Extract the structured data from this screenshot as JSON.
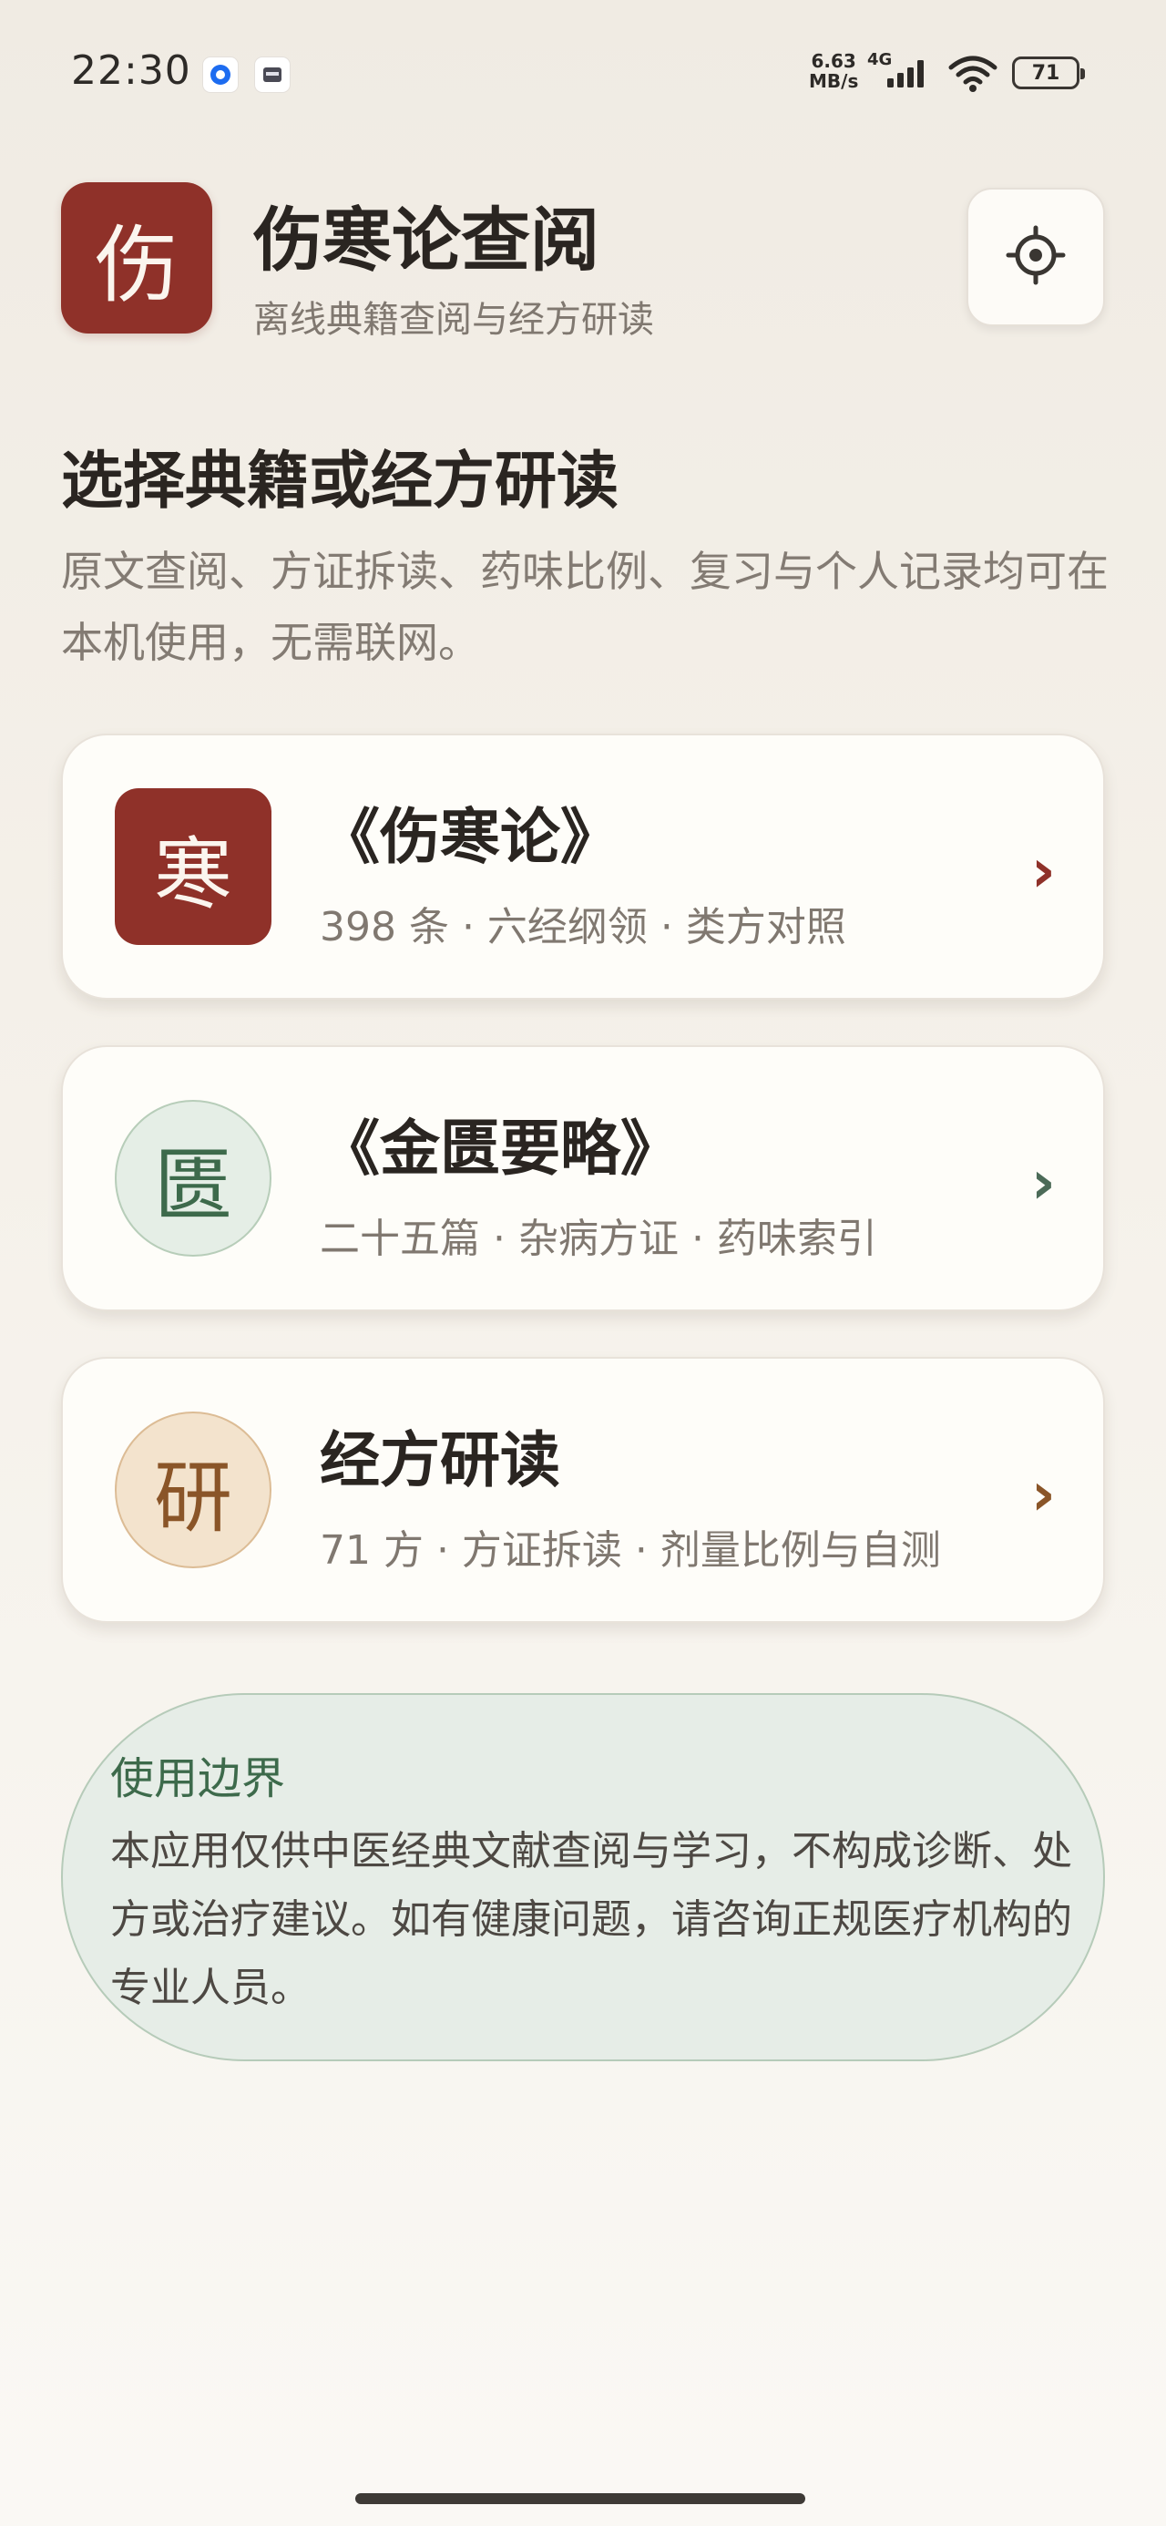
{
  "status_bar": {
    "time": "22:30",
    "net_speed_value": "6.63",
    "net_speed_unit": "MB/s",
    "network_type": "4G",
    "battery": "71"
  },
  "header": {
    "logo_char": "伤",
    "title": "伤寒论查阅",
    "subtitle": "离线典籍查阅与经方研读"
  },
  "intro": {
    "title": "选择典籍或经方研读",
    "description": "原文查阅、方证拆读、药味比例、复习与个人记录均可在本机使用，无需联网。"
  },
  "cards": [
    {
      "icon_char": "寒",
      "title": "《伤寒论》",
      "meta": "398 条 · 六经纲领 · 类方对照"
    },
    {
      "icon_char": "匮",
      "title": "《金匮要略》",
      "meta": "二十五篇 · 杂病方证 · 药味索引"
    },
    {
      "icon_char": "研",
      "title": "经方研读",
      "meta": "71 方 · 方证拆读 · 剂量比例与自测"
    }
  ],
  "notice": {
    "title": "使用边界",
    "body": "本应用仅供中医经典文献查阅与学习，不构成诊断、处方或治疗建议。如有健康问题，请咨询正规医疗机构的专业人员。"
  },
  "colors": {
    "brand_red": "#8f3129",
    "sage_green": "#3d6a4b",
    "tan_brown": "#8a5528",
    "background": "#f3efe8"
  },
  "icons": {
    "settings": "gear-icon",
    "chevron": "chevron-right-icon"
  }
}
